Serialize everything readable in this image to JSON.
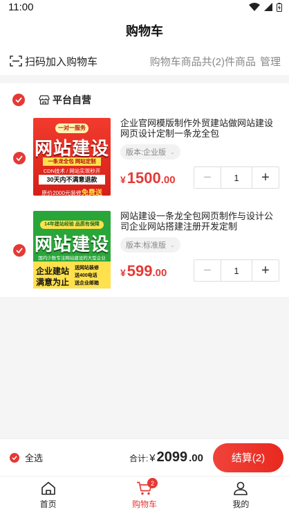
{
  "status_bar": {
    "time": "11:00"
  },
  "header": {
    "title": "购物车"
  },
  "toolbar": {
    "scan_label": "扫码加入购物车",
    "count_text": "购物车商品共(2)件商品",
    "manage_label": "管理"
  },
  "shop": {
    "name": "平台自营"
  },
  "items": [
    {
      "title": "企业官网模版制作外贸建站做网站建设网页设计定制一条龙全包",
      "spec": "版本:企业版",
      "price_symbol": "¥",
      "price_int": "1500",
      "price_dec": ".00",
      "qty": "1",
      "thumb": {
        "top_tag": "一对一服务",
        "headline": "网站建设",
        "line1": "一条龙全包 网站定制",
        "line2": "CDN技术 / 网站实现秒开",
        "banner": "30天内不满意退款",
        "footer_prefix": "原价2000元装修",
        "footer_highlight": "免费送"
      }
    },
    {
      "title": "网站建设一条龙全包网页制作与设计公司企业网站搭建注册开发定制",
      "spec": "版本:标准版",
      "price_symbol": "¥",
      "price_int": "599",
      "price_dec": ".00",
      "qty": "1",
      "thumb": {
        "top_tag": "14年建站经验 品质有保障",
        "headline": "网站建设",
        "subline": "国内少数专注网站建设的大型企业",
        "left_text_1": "企业建站",
        "left_text_2": "满意为止",
        "bullets": [
          "送网站装修",
          "送400电话",
          "送企业邮箱"
        ]
      }
    }
  ],
  "footer": {
    "select_all_label": "全选",
    "total_prefix": "合计:",
    "total_symbol": "¥",
    "total_int": "2099",
    "total_dec": ".00",
    "checkout_label": "结算(2)"
  },
  "tabs": [
    {
      "label": "首页",
      "icon": "home-icon"
    },
    {
      "label": "购物车",
      "icon": "cart-icon",
      "badge": "2"
    },
    {
      "label": "我的",
      "icon": "user-icon"
    }
  ],
  "colors": {
    "accent": "#e53935",
    "background": "#f5f5f5"
  }
}
